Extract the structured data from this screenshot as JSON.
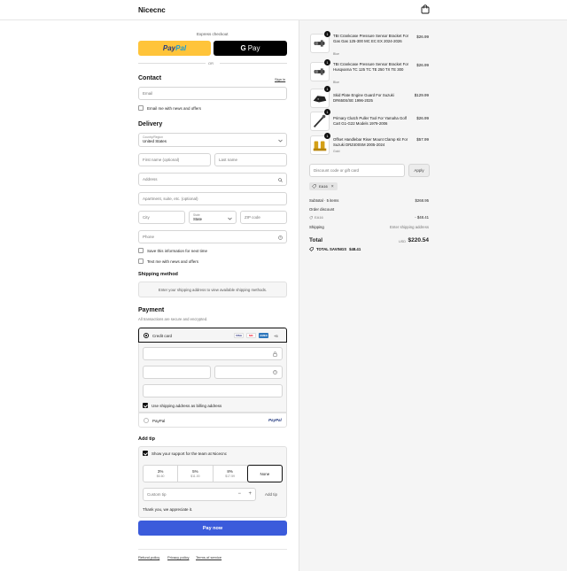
{
  "header": {
    "store_name": "Nicecnc",
    "cart_icon": "shopping-bag-icon"
  },
  "express": {
    "title": "Express checkout",
    "paypal_label_1": "Pay",
    "paypal_label_2": "Pal",
    "gpay_label_g": "G",
    "gpay_label": "Pay",
    "or": "OR"
  },
  "contact": {
    "title": "Contact",
    "sign_in": "Sign in",
    "email_placeholder": "Email",
    "email_news": "Email me with news and offers"
  },
  "delivery": {
    "title": "Delivery",
    "country_label": "Country/Region",
    "country_value": "United States",
    "first_name": "First name (optional)",
    "last_name": "Last name",
    "address": "Address",
    "apartment": "Apartment, suite, etc. (optional)",
    "city": "City",
    "state_label": "State",
    "state_value": "State",
    "zip": "ZIP code",
    "phone": "Phone",
    "save_info": "Save this information for next time",
    "text_news": "Text me with news and offers"
  },
  "shipping": {
    "title": "Shipping method",
    "message": "Enter your shipping address to view available shipping methods."
  },
  "payment": {
    "title": "Payment",
    "subtitle": "All transactions are secure and encrypted.",
    "credit_card": "Credit card",
    "card_logos": [
      "VISA",
      "MC",
      "AMEX"
    ],
    "more_cards": "+5",
    "billing_same": "Use shipping address as billing address",
    "paypal": "PayPal",
    "paypal_logo": "PayPal"
  },
  "tip": {
    "title": "Add tip",
    "show_support": "Show your support for the team at Nicecnc",
    "options": [
      {
        "pct": "3%",
        "amt": "$6.60"
      },
      {
        "pct": "5%",
        "amt": "$11.00"
      },
      {
        "pct": "8%",
        "amt": "$17.59"
      },
      {
        "pct": "None",
        "amt": ""
      }
    ],
    "custom_placeholder": "Custom tip",
    "minus": "−",
    "plus": "+",
    "add_tip": "Add tip",
    "thanks": "Thank you, we appreciate it."
  },
  "pay_now": "Pay now",
  "footer": {
    "refund": "Refund policy",
    "privacy": "Privacy policy",
    "terms": "Terms of service"
  },
  "cart": {
    "items": [
      {
        "title": "TBI Crankcase Pressure Sensor Bracket For Gas Gas 125-300 MC EC EX 2024-2026",
        "variant": "Blue",
        "qty": "1",
        "price": "$26.99"
      },
      {
        "title": "TBI Crankcase Pressure Sensor Bracket For Husqvarna TC 125 TC TE 250 TX TE 300",
        "variant": "Blue",
        "qty": "1",
        "price": "$26.99"
      },
      {
        "title": "Skid Plate Engine Guard For Suzuki DR650S/SE 1996-2025",
        "variant": "",
        "qty": "1",
        "price": "$129.99"
      },
      {
        "title": "Primary Clutch Puller Tool For Yamaha Golf Cart G1-G22 Models 1979-2006",
        "variant": "",
        "qty": "1",
        "price": "$26.99"
      },
      {
        "title": "Offset Handlebar Riser Mount Clamp Kit For Suzuki DRZ400SM 2005-2024",
        "variant": "Gold",
        "qty": "1",
        "price": "$57.99"
      }
    ],
    "discount_placeholder": "Discount code or gift card",
    "apply": "Apply",
    "code_tag": "EA16",
    "subtotal_label": "Subtotal · 5 items",
    "subtotal": "$268.95",
    "order_discount_label": "Order discount",
    "discount_code": "EA16",
    "discount_value": "- $48.41",
    "shipping_label": "Shipping",
    "shipping_value": "Enter shipping address",
    "total_label": "Total",
    "currency": "USD",
    "total": "$220.54",
    "savings_label": "TOTAL SAVINGS",
    "savings": "$48.41"
  }
}
